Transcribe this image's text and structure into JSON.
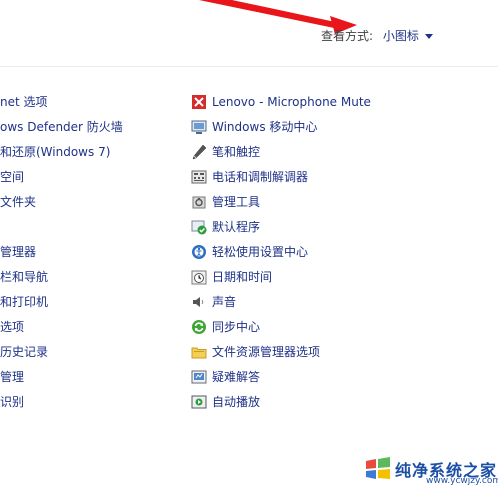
{
  "header": {
    "view_by_label": "查看方式:",
    "view_by_value": "小图标"
  },
  "left_items": [
    "net 选项",
    "ows Defender 防火墙",
    "和还原(Windows 7)",
    "空间",
    "文件夹",
    "",
    "管理器",
    "栏和导航",
    "和打印机",
    "选项",
    "历史记录",
    "管理",
    "识别"
  ],
  "right_items": [
    {
      "label": "Lenovo - Microphone Mute",
      "icon": "microphone-mute-icon"
    },
    {
      "label": "Windows 移动中心",
      "icon": "mobility-center-icon"
    },
    {
      "label": "笔和触控",
      "icon": "pen-icon"
    },
    {
      "label": "电话和调制解调器",
      "icon": "phone-modem-icon"
    },
    {
      "label": "管理工具",
      "icon": "admin-tools-icon"
    },
    {
      "label": "默认程序",
      "icon": "default-programs-icon"
    },
    {
      "label": "轻松使用设置中心",
      "icon": "ease-of-access-icon"
    },
    {
      "label": "日期和时间",
      "icon": "clock-icon"
    },
    {
      "label": "声音",
      "icon": "speaker-icon"
    },
    {
      "label": "同步中心",
      "icon": "sync-icon"
    },
    {
      "label": "文件资源管理器选项",
      "icon": "folder-options-icon"
    },
    {
      "label": "疑难解答",
      "icon": "troubleshooting-icon"
    },
    {
      "label": "自动播放",
      "icon": "autoplay-icon"
    }
  ],
  "watermark": {
    "title": "纯净系统之家",
    "url": "www.ycwjzy.com"
  },
  "colors": {
    "link": "#1e3287",
    "arrow": "#e8151b",
    "watermark": "#1b4fa6"
  }
}
